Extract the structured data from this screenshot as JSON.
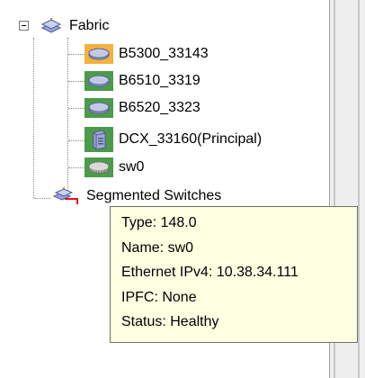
{
  "tree": {
    "root": {
      "label": "Fabric",
      "icon": "fabric-icon"
    },
    "switches": [
      {
        "label": "B5300_33143",
        "icon": "switch-icon",
        "status_color": "#f4b13f"
      },
      {
        "label": "B6510_3319",
        "icon": "switch-icon",
        "status_color": "#4c9a4c"
      },
      {
        "label": "B6520_3323",
        "icon": "switch-icon",
        "status_color": "#4c9a4c"
      },
      {
        "label": "DCX_33160(Principal)",
        "icon": "chassis-icon",
        "status_color": "#4c9a4c"
      },
      {
        "label": "sw0",
        "icon": "virtual-switch-icon",
        "status_color": "#4c9a4c"
      }
    ],
    "segmented": {
      "label": "Segmented Switches",
      "icon": "segmented-switches-icon"
    }
  },
  "tooltip": {
    "lines": [
      "Type: 148.0",
      "Name: sw0",
      "Ethernet IPv4: 10.38.34.111",
      "IPFC: None",
      "Status: Healthy"
    ]
  },
  "colors": {
    "tooltip_bg": "#ffffe1",
    "warning": "#f4b13f",
    "healthy": "#4c9a4c"
  }
}
